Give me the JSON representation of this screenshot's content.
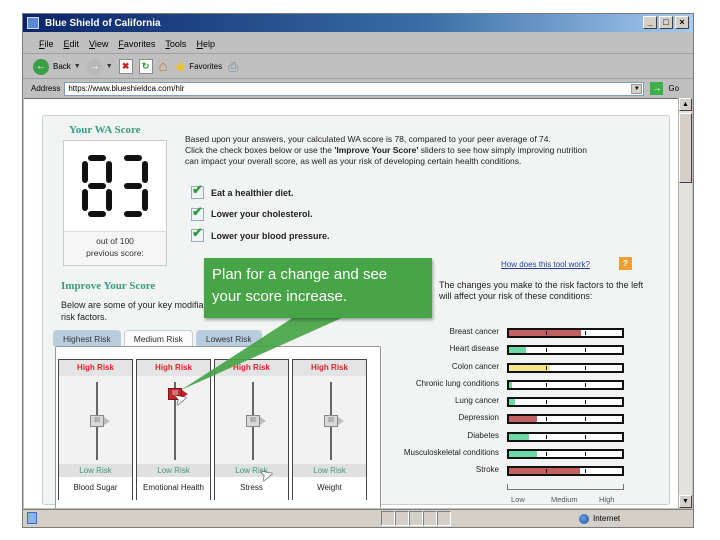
{
  "window": {
    "title": "Blue Shield of California",
    "controls": [
      "_",
      "□",
      "×"
    ]
  },
  "menu": [
    "File",
    "Edit",
    "View",
    "Favorites",
    "Tools",
    "Help"
  ],
  "toolbar": {
    "back_label": "Back",
    "favorites_label": "Favorites",
    "icons": [
      "back-icon",
      "forward-icon",
      "stop-icon",
      "refresh-icon",
      "home-icon",
      "favorites-star-icon",
      "print-icon"
    ]
  },
  "address": {
    "label": "Address",
    "url": "https://www.blueshieldca.com/hlr",
    "go_label": "Go"
  },
  "score": {
    "title": "Your WA Score",
    "value": "83",
    "out_of": "out of 100",
    "previous_label": "previous score:"
  },
  "intro": {
    "line1": "Based upon your answers, your calculated WA score is 78, compared to your peer average of 74.",
    "line2_pre": "Click the check boxes below or use the ",
    "line2_bold": "'Improve Your Score'",
    "line2_post": " sliders to see how simply improving nutrition",
    "line3": "can impact your overall score, as well as your risk of developing certain health conditions."
  },
  "checks": [
    {
      "label": "Eat a healthier diet.",
      "checked": true
    },
    {
      "label": "Lower your cholesterol.",
      "checked": true
    },
    {
      "label": "Lower your blood pressure.",
      "checked": true
    }
  ],
  "callout": {
    "line1": "Plan for a change and see",
    "line2": "your score increase."
  },
  "improve": {
    "title": "Improve Your Score",
    "text": "Below are some of your key modifiable risk factors."
  },
  "tabs": [
    {
      "label": "Highest Risk",
      "active": false
    },
    {
      "label": "Medium Risk",
      "active": true
    },
    {
      "label": "Lowest Risk",
      "active": false
    }
  ],
  "sliders": [
    {
      "name": "Blood Sugar",
      "high": "High Risk",
      "low": "Low Risk",
      "level": 0.5,
      "active": false
    },
    {
      "name": "Emotional Health",
      "high": "High Risk",
      "low": "Low Risk",
      "level": 0.85,
      "active": true
    },
    {
      "name": "Stress",
      "high": "High Risk",
      "low": "Low Risk",
      "level": 0.5,
      "active": false
    },
    {
      "name": "Weight",
      "high": "High Risk",
      "low": "Low Risk",
      "level": 0.5,
      "active": false
    }
  ],
  "help": {
    "link": "How does this tool work?",
    "icon_label": "?"
  },
  "risk_intro": "The changes you make to the risk factors to the left will affect your risk of these conditions:",
  "risks": [
    {
      "label": "Breast cancer",
      "level": 0.64,
      "color": "#c06060"
    },
    {
      "label": "Heart disease",
      "level": 0.15,
      "color": "#6fd8a8"
    },
    {
      "label": "Colon cancer",
      "level": 0.36,
      "color": "#f5e68e"
    },
    {
      "label": "Chronic lung conditions",
      "level": 0.03,
      "color": "#6fd8a8"
    },
    {
      "label": "Lung cancer",
      "level": 0.05,
      "color": "#6fd8a8"
    },
    {
      "label": "Depression",
      "level": 0.25,
      "color": "#c06060"
    },
    {
      "label": "Diabetes",
      "level": 0.18,
      "color": "#6fd8a8"
    },
    {
      "label": "Musculoskeletal conditions",
      "level": 0.25,
      "color": "#6fd8a8"
    },
    {
      "label": "Stroke",
      "level": 0.63,
      "color": "#c06060"
    }
  ],
  "risk_scale": [
    "Low",
    "Medium",
    "High"
  ],
  "status": {
    "zone": "Internet"
  },
  "colors": {
    "accent_green": "#3a9b80",
    "callout_green": "#47a447",
    "high_risk_red": "#e0242a",
    "link_blue": "#2a3fa0"
  }
}
